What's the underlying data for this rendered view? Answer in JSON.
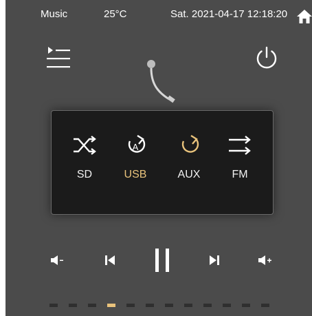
{
  "status": {
    "app": "Music",
    "temperature": "25°C",
    "datetime": "Sat. 2021-04-17 12:18:20"
  },
  "icons": {
    "home": "home-icon",
    "playlist": "playlist-icon",
    "power": "power-icon",
    "tonearm": "tonearm-icon"
  },
  "sources": [
    {
      "label": "SD",
      "icon": "shuffle-icon",
      "active": false
    },
    {
      "label": "USB",
      "icon": "repeat-one-icon",
      "active": true
    },
    {
      "label": "AUX",
      "icon": "repeat-icon",
      "active": false
    },
    {
      "label": "FM",
      "icon": "sequential-icon",
      "active": false
    }
  ],
  "controls": [
    "volume-down-icon",
    "previous-icon",
    "pause-icon",
    "next-icon",
    "volume-up-icon"
  ],
  "pagination": {
    "total": 12,
    "active_index": 4
  },
  "colors": {
    "panel": "#4b4b4b",
    "box": "#1b1b1b",
    "accent": "#e9c37c",
    "text": "#ffffff"
  }
}
